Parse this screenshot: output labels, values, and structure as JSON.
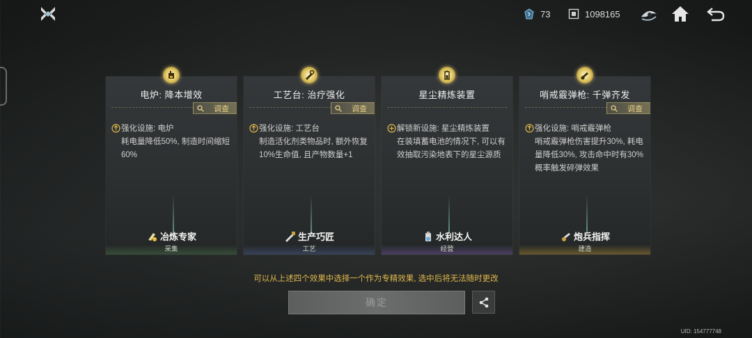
{
  "topbar": {
    "resource1": {
      "icon": "energy-crystal-icon",
      "value": "73"
    },
    "resource2": {
      "icon": "currency-chip-icon",
      "value": "1098165"
    },
    "icons": [
      "eye-badge-icon",
      "home-icon",
      "back-arrow-icon"
    ]
  },
  "cards": [
    {
      "title": "电炉: 降本增效",
      "investigate": "调查",
      "desc_head": "强化设施: 电炉",
      "desc_body": "耗电量降低50%, 制造时间缩短60%",
      "skill": "冶炼专家",
      "category": "采集",
      "badge_icon": "furnace-icon"
    },
    {
      "title": "工艺台: 治疗强化",
      "investigate": "调查",
      "desc_head": "强化设施: 工艺台",
      "desc_body": "制造活化剂类物品时, 额外恢复10%生命值, 且产物数量+1",
      "skill": "生产巧匠",
      "category": "工艺",
      "badge_icon": "wrench-icon"
    },
    {
      "title": "星尘精炼装置",
      "investigate": "",
      "desc_head": "解锁新设施: 星尘精炼装置",
      "desc_body": "在装填蓄电池的情况下, 可以有效抽取污染地表下的星尘源质",
      "skill": "水利达人",
      "category": "经营",
      "badge_icon": "battery-icon"
    },
    {
      "title": "哨戒霰弹枪: 千弹齐发",
      "investigate": "调查",
      "desc_head": "强化设施: 哨戒霰弹枪",
      "desc_body": "哨戒霰弹枪伤害提升30%, 耗电量降低30%, 攻击命中时有30%概率触发碎弹效果",
      "skill": "炮兵指挥",
      "category": "建造",
      "badge_icon": "turret-icon"
    }
  ],
  "notice": "可以从上述四个效果中选择一个作为专精效果, 选中后将无法随时更改",
  "confirm_label": "确定",
  "uid": "UID: 154777748",
  "colors": {
    "accent_gold": "#e0b84a",
    "investigate": "#e6cf86"
  }
}
